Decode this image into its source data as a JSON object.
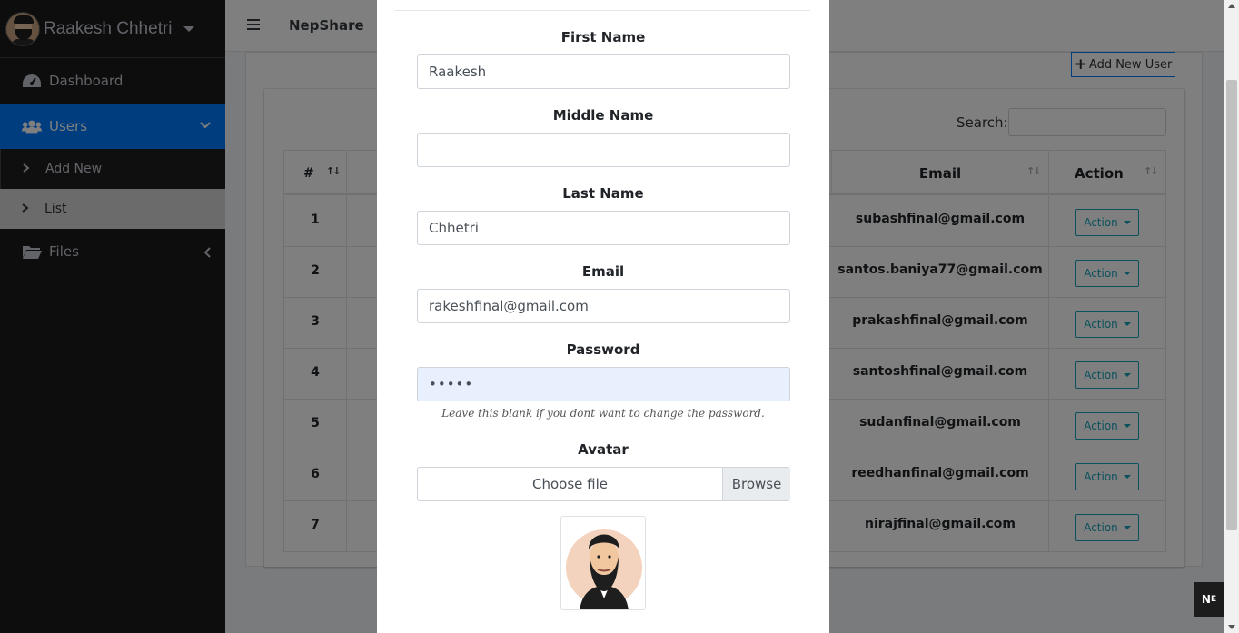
{
  "sidebar": {
    "user_name": "Raakesh Chhetri",
    "items": [
      {
        "label": "Dashboard",
        "icon": "dashboard-icon"
      },
      {
        "label": "Users",
        "icon": "users-icon"
      },
      {
        "label": "Files",
        "icon": "folder-icon"
      }
    ],
    "sub_items": [
      {
        "label": "Add New"
      },
      {
        "label": "List"
      }
    ]
  },
  "topnav": {
    "brand": "NepShare"
  },
  "page": {
    "add_user_label": "Add New User",
    "search_label": "Search:"
  },
  "table": {
    "headers": {
      "num": "#",
      "email": "Email",
      "action": "Action"
    },
    "rows": [
      {
        "num": "1",
        "email": "subashfinal@gmail.com",
        "action": "Action"
      },
      {
        "num": "2",
        "email": "santos.baniya77@gmail.com",
        "action": "Action"
      },
      {
        "num": "3",
        "email": "prakashfinal@gmail.com",
        "action": "Action"
      },
      {
        "num": "4",
        "email": "santoshfinal@gmail.com",
        "action": "Action"
      },
      {
        "num": "5",
        "email": "sudanfinal@gmail.com",
        "action": "Action"
      },
      {
        "num": "6",
        "email": "reedhanfinal@gmail.com",
        "action": "Action"
      },
      {
        "num": "7",
        "email": "nirajfinal@gmail.com",
        "action": "Action"
      }
    ]
  },
  "modal": {
    "first_name_label": "First Name",
    "first_name_value": "Raakesh",
    "middle_name_label": "Middle Name",
    "middle_name_value": "",
    "last_name_label": "Last Name",
    "last_name_value": "Chhetri",
    "email_label": "Email",
    "email_value": "rakeshfinal@gmail.com",
    "password_label": "Password",
    "password_value": "•••••",
    "password_hint": "Leave this blank if you dont want to change the password.",
    "avatar_label": "Avatar",
    "file_choose": "Choose file",
    "file_browse": "Browse"
  },
  "colors": {
    "accent": "#007bff",
    "info": "#17a2b8",
    "sidebar": "#1b1b1b"
  }
}
